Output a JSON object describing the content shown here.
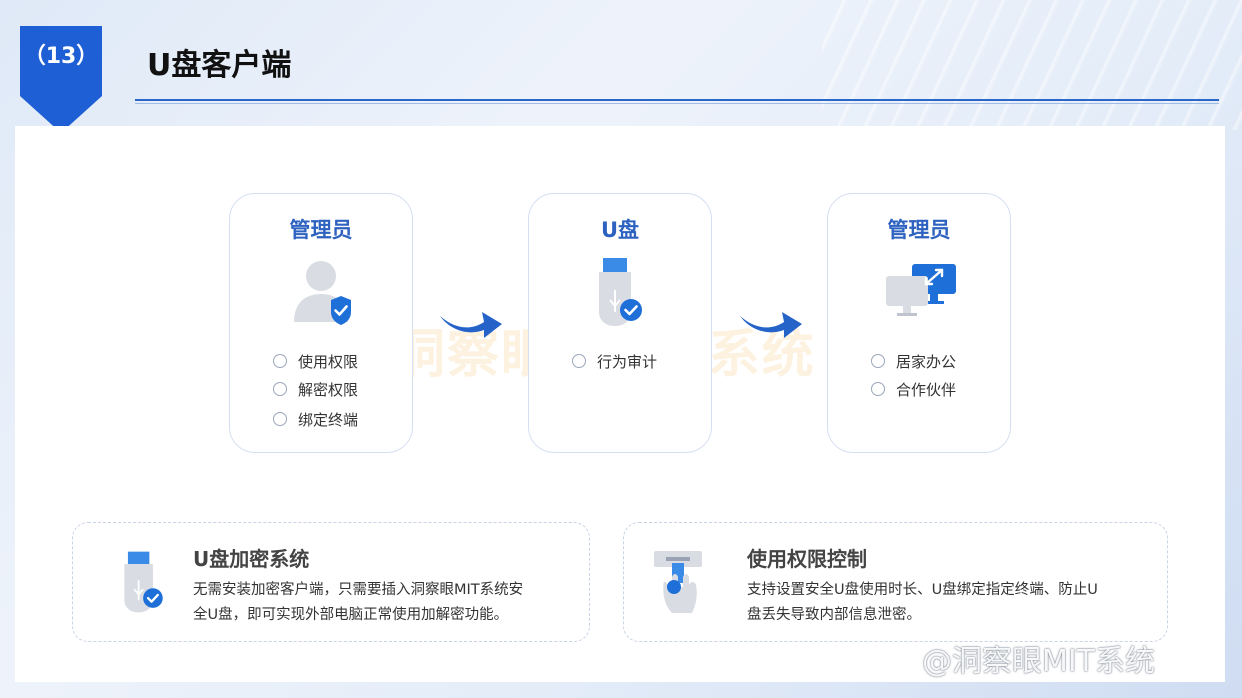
{
  "badge": {
    "label": "（13）"
  },
  "header": {
    "title": "U盘客户端"
  },
  "watermark": "洞察眼 MIT 系统",
  "cards": [
    {
      "title": "管理员",
      "icon": "admin-shield-icon",
      "options": [
        "使用权限",
        "解密权限",
        "绑定终端"
      ]
    },
    {
      "title": "U盘",
      "icon": "usb-drive-check-icon",
      "options": [
        "行为审计"
      ]
    },
    {
      "title": "管理员",
      "icon": "monitors-connect-icon",
      "options": [
        "居家办公",
        "合作伙伴"
      ]
    }
  ],
  "features": [
    {
      "title": "U盘加密系统",
      "icon": "usb-drive-check-icon",
      "desc_lines": [
        "无需安装加密客户端，只需要插入洞察眼MIT系统安",
        "全U盘，即可实现外部电脑正常使用加解密功能。"
      ]
    },
    {
      "title": "使用权限控制",
      "icon": "hand-insert-usb-icon",
      "desc_lines": [
        "支持设置安全U盘使用时长、U盘绑定指定终端、防止U",
        "盘丢失导致内部信息泄密。"
      ]
    }
  ],
  "credit": "@洞察眼MIT系统",
  "colors": {
    "accent": "#2d62c0",
    "badge": "#1f5fd6",
    "icon_blue": "#1f6fd8"
  }
}
